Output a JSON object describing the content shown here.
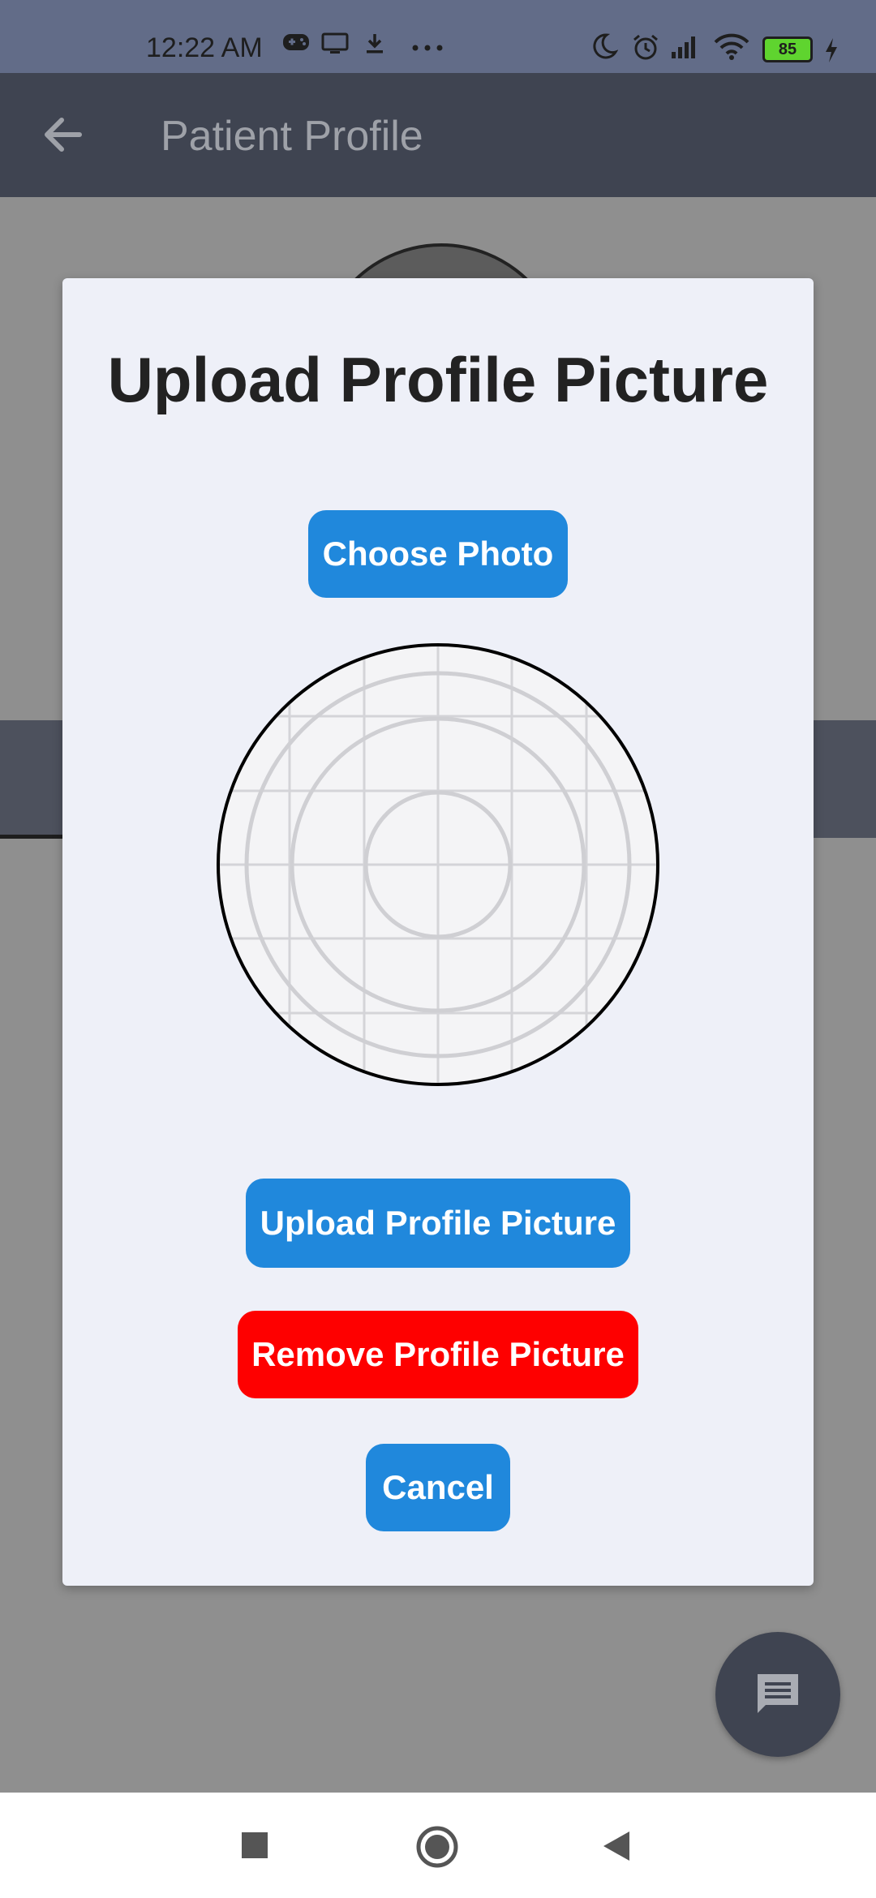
{
  "status_bar": {
    "time": "12:22 AM",
    "battery_level": "85",
    "icons": [
      "gamepad-icon",
      "cast-icon",
      "download-icon",
      "more-icon",
      "moon-icon",
      "alarm-icon",
      "signal-icon",
      "wifi-icon",
      "battery-icon",
      "charging-icon"
    ]
  },
  "app_bar": {
    "title": "Patient Profile",
    "back_icon": "arrow-back-icon"
  },
  "modal": {
    "title": "Upload Profile Picture",
    "choose_photo_label": "Choose Photo",
    "upload_label": "Upload Profile Picture",
    "remove_label": "Remove Profile Picture",
    "cancel_label": "Cancel"
  },
  "fab": {
    "icon": "chat-icon"
  },
  "nav_bar": {
    "icons": [
      "recents-square-icon",
      "home-circle-icon",
      "back-triangle-icon"
    ]
  },
  "colors": {
    "primary": "#2088dc",
    "danger": "#fe0000",
    "appbar": "#3f4451",
    "modal_bg": "#eef0f8"
  }
}
